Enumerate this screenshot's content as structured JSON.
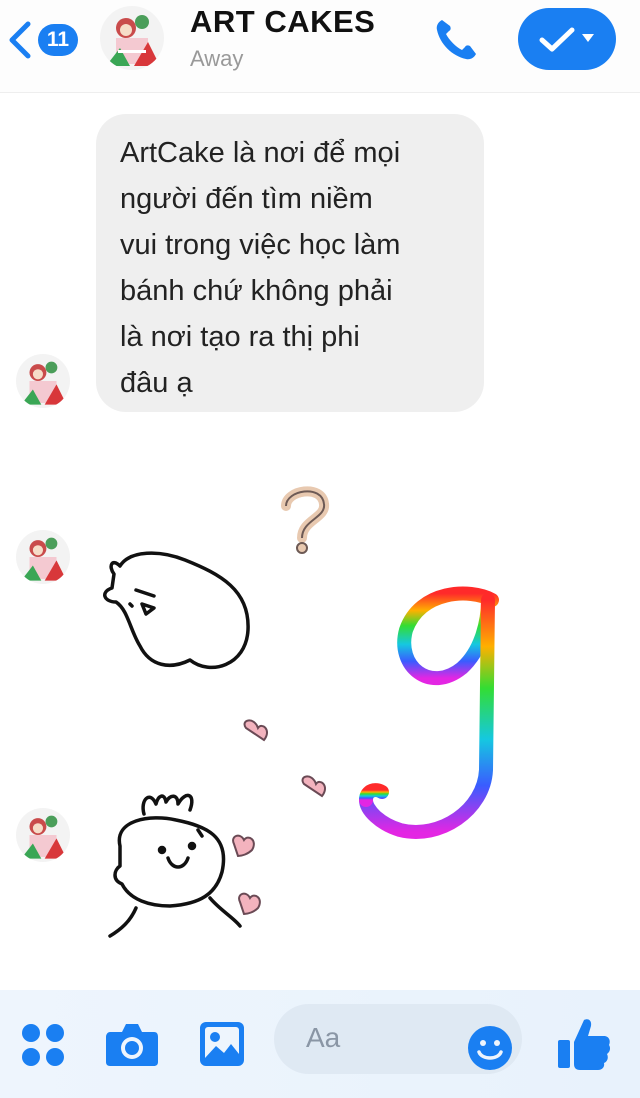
{
  "header": {
    "back_count": "11",
    "title": "ART CAKES",
    "status": "Away"
  },
  "messages": [
    {
      "type": "text",
      "lines": [
        "ArtCake là nơi để mọi",
        "người đến tìm niềm",
        "vui trong việc học làm",
        "bánh chứ không phải",
        "là nơi tạo ra thị phi",
        "đâu ạ"
      ]
    }
  ],
  "composer": {
    "placeholder": "Aa"
  },
  "colors": {
    "accent": "#1a7ff2",
    "bubble": "#efefef"
  },
  "icons": [
    "back-chevron-icon",
    "phone-icon",
    "checkmark-icon",
    "apps-grid-icon",
    "camera-icon",
    "gallery-icon",
    "emoji-icon",
    "thumbs-up-icon"
  ]
}
